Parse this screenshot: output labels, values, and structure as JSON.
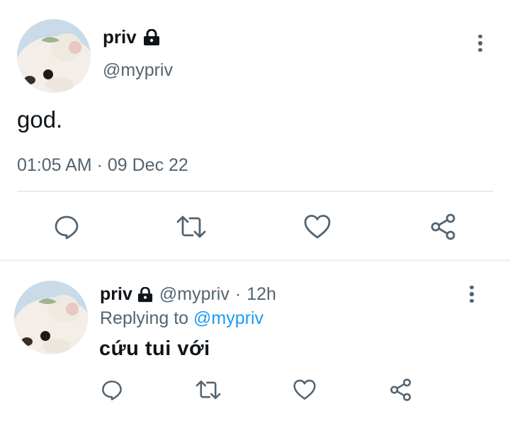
{
  "tweet": {
    "display_name": "priv",
    "handle": "@mypriv",
    "text": "god.",
    "time": "01:05 AM",
    "separator": "·",
    "date": "09 Dec 22"
  },
  "reply": {
    "display_name": "priv",
    "handle": "@mypriv",
    "dot": "·",
    "age": "12h",
    "replying_prefix": "Replying to",
    "replying_handle": "@mypriv",
    "text": "cứu tui với"
  },
  "icons": {
    "locked": "lock-icon",
    "more": "more-vertical-icon",
    "reply": "comment-icon",
    "retweet": "retweet-icon",
    "like": "heart-icon",
    "share": "share-icon"
  },
  "colors": {
    "text_primary": "#0f1419",
    "text_secondary": "#536471",
    "link": "#1d9bf0",
    "divider": "#e6ecf0"
  }
}
